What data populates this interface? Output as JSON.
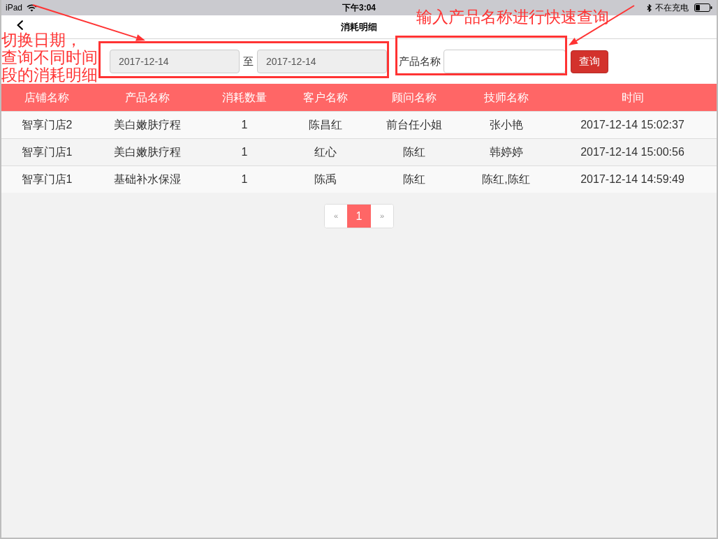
{
  "status_bar": {
    "device": "iPad",
    "time": "下午3:04",
    "charging": "不在充电"
  },
  "nav_bar": {
    "title": "消耗明细"
  },
  "filter": {
    "start_date": {
      "value": "2017-12-14",
      "readonly": true
    },
    "separator": "至",
    "end_date": {
      "value": "2017-12-14",
      "readonly": true
    },
    "product_name": {
      "label": "产品名称",
      "readonly": false
    },
    "search_button": "查询"
  },
  "table": {
    "columns": [
      "店铺名称",
      "产品名称",
      "消耗数量",
      "客户名称",
      "顾问名称",
      "技师名称",
      "时间"
    ],
    "rows": [
      [
        "智享门店2",
        "美白嫩肤疗程",
        "1",
        "陈昌红",
        "前台任小姐",
        "张小艳",
        "2017-12-14 15:02:37"
      ],
      [
        "智享门店1",
        "美白嫩肤疗程",
        "1",
        "红心",
        "陈红",
        "韩婷婷",
        "2017-12-14 15:00:56"
      ],
      [
        "智享门店1",
        "基础补水保湿",
        "1",
        "陈禹",
        "陈红",
        "陈红,陈红",
        "2017-12-14 14:59:49"
      ]
    ]
  },
  "pagination": [
    {
      "kind": "prev",
      "label": "«",
      "selected": false
    },
    {
      "kind": "page",
      "label": "1",
      "selected": true
    },
    {
      "kind": "next",
      "label": "»",
      "selected": false
    }
  ],
  "annotations": [
    {
      "lines": [
        "切换日期，",
        "查询不同时间",
        "段的消耗明细"
      ]
    },
    {
      "lines": [
        "输入产品名称进行快速查询"
      ]
    }
  ]
}
